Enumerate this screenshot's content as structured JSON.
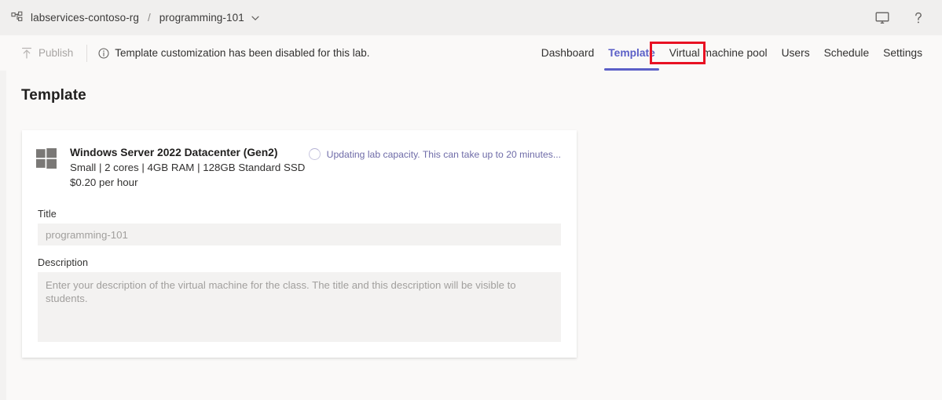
{
  "header": {
    "breadcrumb": {
      "icon": "resource-group-icon",
      "parent": "labservices-contoso-rg",
      "separator": "/",
      "current": "programming-101",
      "chevron": "chevron-down-icon"
    },
    "actions": [
      {
        "icon": "monitor-icon",
        "name": "display-settings"
      },
      {
        "icon": "question-mark-icon",
        "name": "help"
      }
    ]
  },
  "command_bar": {
    "publish": {
      "label": "Publish",
      "icon": "publish-upload-icon",
      "disabled": true
    },
    "info": {
      "icon": "info-circle-icon",
      "text": "Template customization has been disabled for this lab."
    }
  },
  "tabs": [
    {
      "label": "Dashboard",
      "active": false
    },
    {
      "label": "Template",
      "active": true
    },
    {
      "label": "Virtual machine pool",
      "active": false
    },
    {
      "label": "Users",
      "active": false
    },
    {
      "label": "Schedule",
      "active": false
    },
    {
      "label": "Settings",
      "active": false
    }
  ],
  "page": {
    "title": "Template"
  },
  "card": {
    "vm": {
      "icon": "windows-logo-icon",
      "name": "Windows Server 2022 Datacenter (Gen2)",
      "specs": "Small | 2 cores | 4GB RAM | 128GB Standard SSD",
      "price": "$0.20 per hour"
    },
    "status": {
      "icon": "spinner-icon",
      "text": "Updating lab capacity. This can take up to 20 minutes..."
    },
    "title_field": {
      "label": "Title",
      "value": "programming-101",
      "placeholder": "programming-101"
    },
    "description_field": {
      "label": "Description",
      "value": "",
      "placeholder": "Enter your description of the virtual machine for the class. The title and this description will be visible to students."
    }
  },
  "colors": {
    "accent": "#5b5fc7",
    "annotation": "#e81123",
    "header_bg": "#f0efee",
    "page_bg": "#faf9f8",
    "field_bg": "#f3f2f1"
  }
}
